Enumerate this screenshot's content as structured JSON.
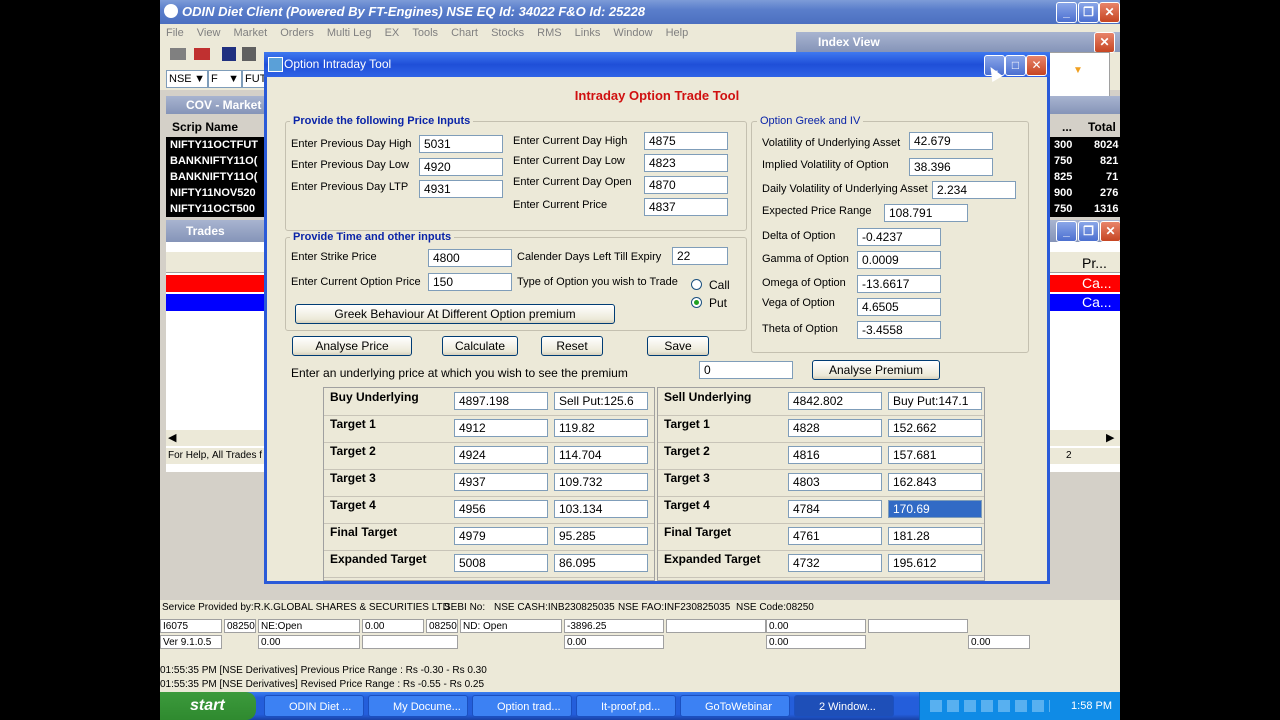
{
  "window": {
    "title": "ODIN Diet Client  (Powered By FT-Engines)  NSE EQ Id: 34022  F&O Id: 25228",
    "menu": [
      "File",
      "View",
      "Market",
      "Orders",
      "Multi Leg",
      "EX",
      "Tools",
      "Chart",
      "Stocks",
      "RMS",
      "Links",
      "Window",
      "Help"
    ],
    "toolbar": {
      "exchange": "NSE",
      "segment": "F",
      "instrument": "FUT"
    }
  },
  "index_view": {
    "title": "Index View"
  },
  "market_watch": {
    "title": "COV  - Market",
    "col_scrip": "Scrip Name",
    "col_total": "Total .",
    "rows": [
      {
        "scrip": "NIFTY11OCTFUT",
        "a": "300",
        "b": "8024"
      },
      {
        "scrip": "BANKNIFTY11O(",
        "a": "750",
        "b": "821"
      },
      {
        "scrip": "BANKNIFTY11O(",
        "a": "825",
        "b": "71"
      },
      {
        "scrip": "NIFTY11NOV520",
        "a": "900",
        "b": "276"
      },
      {
        "scrip": "NIFTY11OCT500",
        "a": "750",
        "b": "1316"
      }
    ]
  },
  "trades": {
    "title": "Trades",
    "col_pr": "Pr...",
    "row1": "Ca...",
    "row2": "Ca...",
    "help": "For Help,",
    "all_trades": "All Trades f",
    "page": "2"
  },
  "dialog": {
    "title": "Option Intraday Tool",
    "heading": "Intraday Option Trade Tool",
    "price_inputs": {
      "legend": "Provide the following Price Inputs",
      "prev_high_label": "Enter Previous Day High",
      "prev_high": "5031",
      "prev_low_label": "Enter Previous Day Low",
      "prev_low": "4920",
      "prev_ltp_label": "Enter Previous Day LTP",
      "prev_ltp": "4931",
      "cur_high_label": "Enter Current Day High",
      "cur_high": "4875",
      "cur_low_label": "Enter Current Day Low",
      "cur_low": "4823",
      "cur_open_label": "Enter Current  Day Open",
      "cur_open": "4870",
      "cur_price_label": "Enter Current  Price",
      "cur_price": "4837"
    },
    "time_inputs": {
      "legend": "Provide Time and other inputs",
      "strike_label": "Enter Strike Price",
      "strike": "4800",
      "days_label": "Calender Days Left Till Expiry",
      "days": "22",
      "opt_price_label": "Enter Current Option Price",
      "opt_price": "150",
      "type_label": "Type of Option you wish to Trade",
      "call": "Call",
      "put": "Put",
      "greek_button": "Greek Behaviour At Different Option premium"
    },
    "greeks": {
      "legend": "Option Greek and IV",
      "vol_label": "Volatility of Underlying Asset",
      "vol": "42.679",
      "iv_label": "Implied Volatility of Option",
      "iv": "38.396",
      "dvol_label": "Daily Volatility of Underlying Asset",
      "dvol": "2.234",
      "range_label": "Expected Price Range",
      "range": "108.791",
      "delta_label": "Delta of Option",
      "delta": "-0.4237",
      "gamma_label": "Gamma of Option",
      "gamma": "0.0009",
      "omega_label": "Omega of Option",
      "omega": "-13.6617",
      "vega_label": "Vega of Option",
      "vega": "4.6505",
      "theta_label": "Theta of Option",
      "theta": "-3.4558"
    },
    "buttons": {
      "analyse_price": "Analyse Price",
      "calculate": "Calculate",
      "reset": "Reset",
      "save": "Save",
      "analyse_premium": "Analyse Premium"
    },
    "premium_prompt": "Enter an underlying price at which you wish to see the premium",
    "premium_input": "0",
    "buy_table": {
      "rows": [
        {
          "label": "Buy Underlying",
          "price": "4897.198",
          "put": "Sell Put:125.6"
        },
        {
          "label": "Target 1",
          "price": "4912",
          "put": "119.82"
        },
        {
          "label": "Target 2",
          "price": "4924",
          "put": "114.704"
        },
        {
          "label": "Target 3",
          "price": "4937",
          "put": "109.732"
        },
        {
          "label": "Target 4",
          "price": "4956",
          "put": "103.134"
        },
        {
          "label": "Final Target",
          "price": "4979",
          "put": "95.285"
        },
        {
          "label": "Expanded Target",
          "price": "5008",
          "put": "86.095"
        }
      ]
    },
    "sell_table": {
      "rows": [
        {
          "label": "Sell Underlying",
          "price": "4842.802",
          "put": "Buy Put:147.1"
        },
        {
          "label": "Target 1",
          "price": "4828",
          "put": "152.662"
        },
        {
          "label": "Target 2",
          "price": "4816",
          "put": "157.681"
        },
        {
          "label": "Target 3",
          "price": "4803",
          "put": "162.843"
        },
        {
          "label": "Target 4",
          "price": "4784",
          "put": "170.69"
        },
        {
          "label": "Final Target",
          "price": "4761",
          "put": "181.28"
        },
        {
          "label": "Expanded Target",
          "price": "4732",
          "put": "195.612"
        }
      ]
    }
  },
  "statusbar": {
    "provider": "Service Provided by:R.K.GLOBAL SHARES & SECURITIES LTD",
    "sebi": "SEBI No:",
    "nse_cash": "NSE CASH:INB230825035",
    "nse_fao": "NSE FAO:INF230825035",
    "nse_code": "NSE Code:08250",
    "row1": [
      "I6075",
      "08250",
      "NE:Open",
      "0.00",
      "08250",
      "ND: Open",
      "-3896.25",
      "",
      "0.00",
      ""
    ],
    "row2": [
      "Ver 9.1.0.5",
      "",
      "0.00",
      "",
      "0.00",
      "",
      "0.00",
      ""
    ],
    "msg1": "01:55:35 PM [NSE Derivatives] Previous Price Range : Rs -0.30 - Rs 0.30",
    "msg2": "01:55:35 PM [NSE Derivatives] Revised Price Range  : Rs -0.55 - Rs 0.25"
  },
  "taskbar": {
    "start": "start",
    "items": [
      "ODIN Diet ...",
      "My Docume...",
      "Option trad...",
      "It-proof.pd...",
      "GoToWebinar",
      "2 Window..."
    ],
    "clock": "1:58 PM"
  }
}
